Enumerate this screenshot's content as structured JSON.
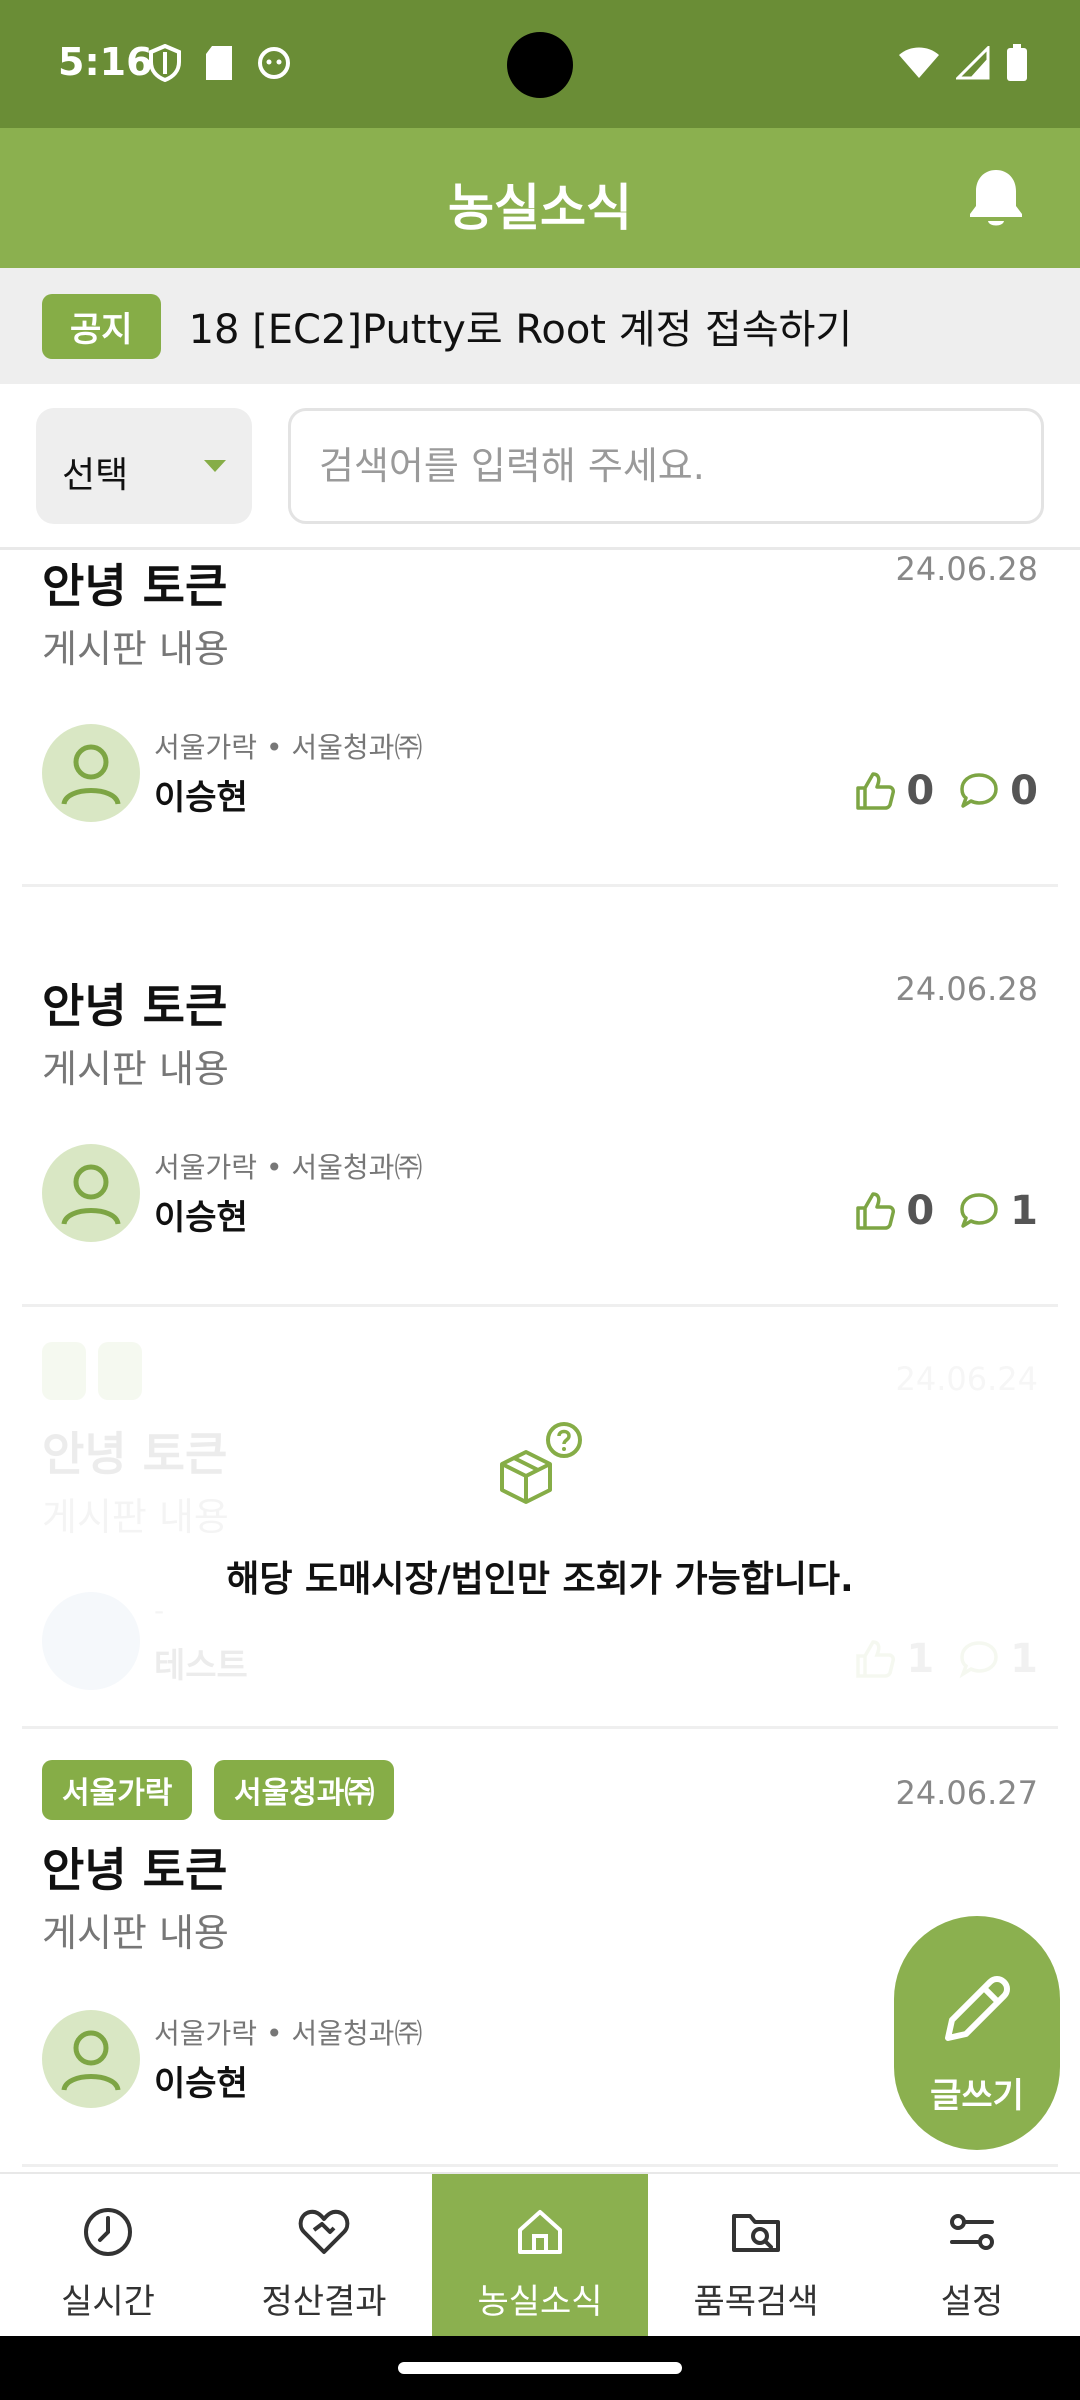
{
  "status_bar": {
    "time": "5:16",
    "left_icons": [
      "shield-icon",
      "sd-card-icon",
      "face-icon"
    ],
    "right_icons": [
      "wifi-icon",
      "signal-icon",
      "battery-icon"
    ]
  },
  "header": {
    "title": "농실소식",
    "bell_icon": "bell-icon"
  },
  "notice": {
    "badge": "공지",
    "text": "18 [EC2]Putty로 Root 계정 접속하기"
  },
  "search": {
    "select_label": "선택",
    "placeholder": "검색어를 입력해 주세요."
  },
  "posts": [
    {
      "title": "안녕 토큰",
      "content": "게시판 내용",
      "date": "24.06.28",
      "author_meta": "서울가락 • 서울청과㈜",
      "author": "이승현",
      "likes": "0",
      "comments": "0"
    },
    {
      "title": "안녕 토큰",
      "content": "게시판 내용",
      "date": "24.06.28",
      "author_meta": "서울가락 • 서울청과㈜",
      "author": "이승현",
      "likes": "0",
      "comments": "1"
    },
    {
      "title": "안녕 토큰",
      "content": "게시판 내용",
      "date": "24.06.24",
      "author_meta": "-",
      "author": "테스트",
      "likes": "1",
      "comments": "1",
      "restricted_message": "해당 도매시장/법인만 조회가 가능합니다."
    },
    {
      "tags": [
        "서울가락",
        "서울청과㈜"
      ],
      "title": "안녕 토큰",
      "content": "게시판 내용",
      "date": "24.06.27",
      "author_meta": "서울가락 • 서울청과㈜",
      "author": "이승현"
    }
  ],
  "fab": {
    "label": "글쓰기",
    "icon": "pencil-icon"
  },
  "bottom_nav": [
    {
      "label": "실시간",
      "icon": "clock-icon",
      "active": false
    },
    {
      "label": "정산결과",
      "icon": "heart-handshake-icon",
      "active": false
    },
    {
      "label": "농실소식",
      "icon": "home-icon",
      "active": true
    },
    {
      "label": "품목검색",
      "icon": "folder-search-icon",
      "active": false
    },
    {
      "label": "설정",
      "icon": "settings-sliders-icon",
      "active": false
    }
  ],
  "colors": {
    "status_bar": "#6a8d36",
    "accent": "#8bb04f",
    "tag": "#86ad47"
  }
}
